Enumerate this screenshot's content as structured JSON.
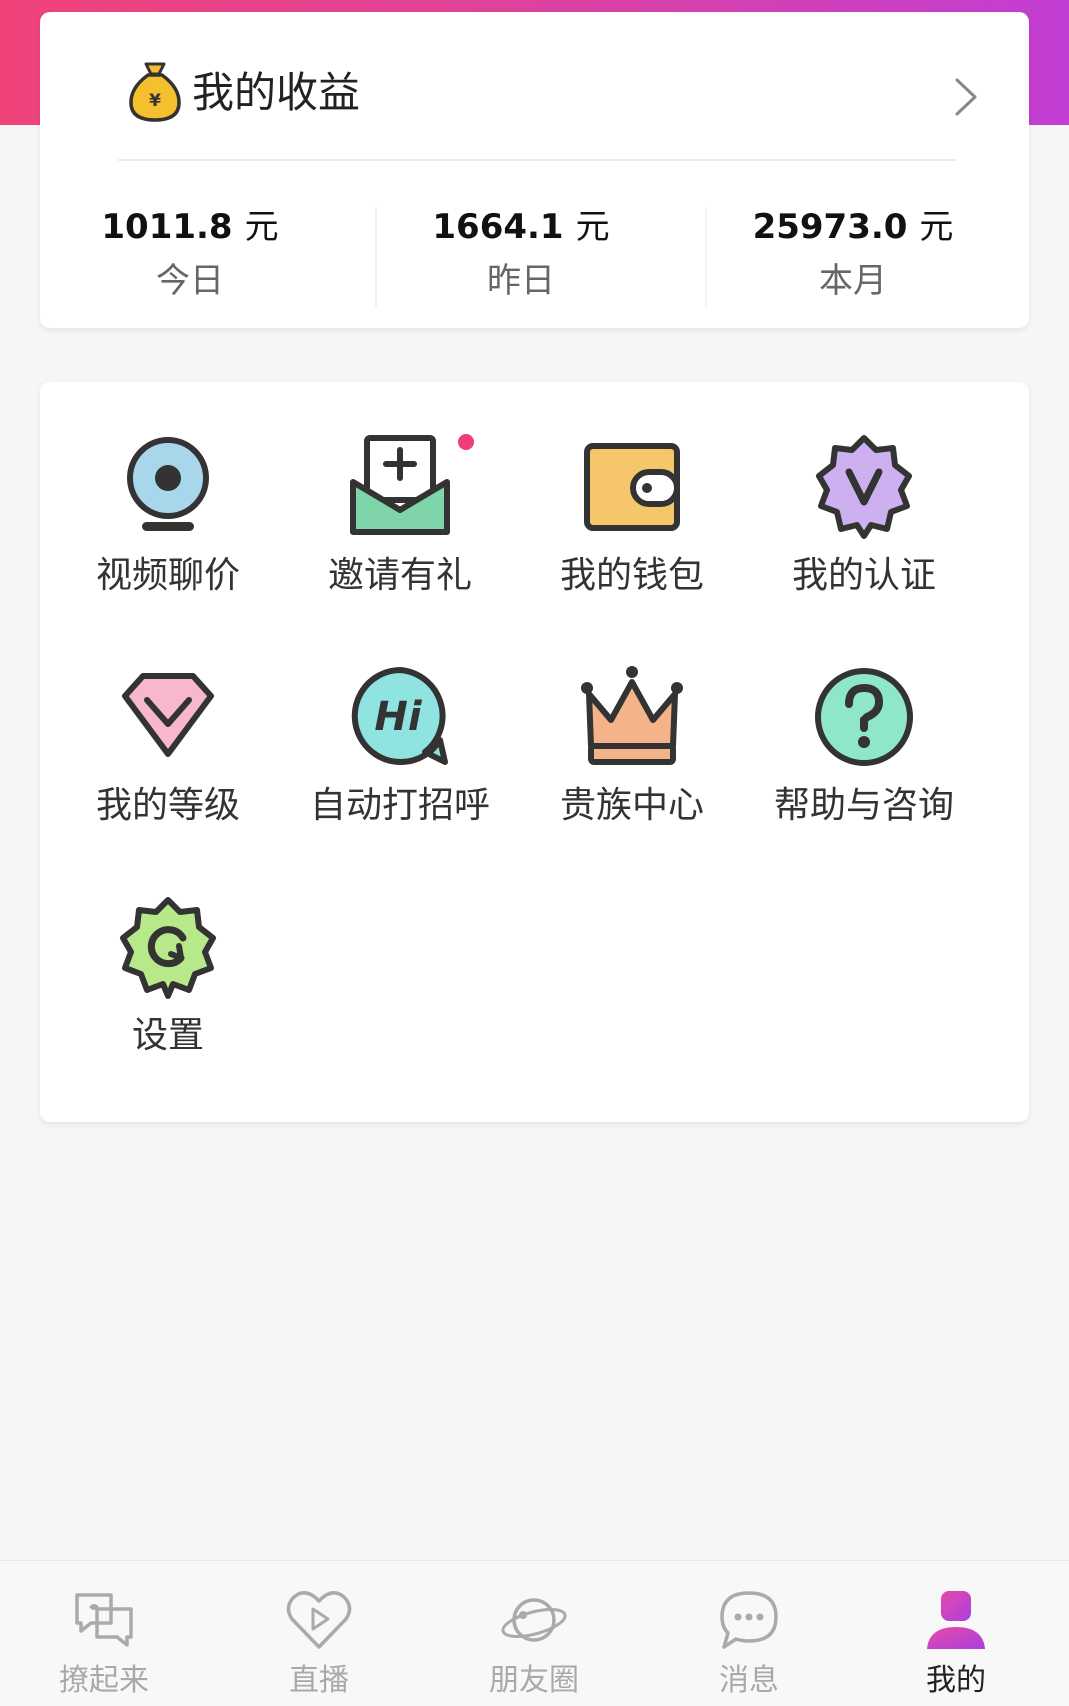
{
  "earnings": {
    "title": "我的收益",
    "stats": [
      {
        "value": "1011.8",
        "unit": "元",
        "label": "今日"
      },
      {
        "value": "1664.1",
        "unit": "元",
        "label": "昨日"
      },
      {
        "value": "25973.0",
        "unit": "元",
        "label": "本月"
      }
    ],
    "icon": "money-bag-icon"
  },
  "menu": {
    "items": [
      {
        "label": "视频聊价",
        "icon": "webcam-icon"
      },
      {
        "label": "邀请有礼",
        "icon": "invite-envelope-icon",
        "badge_dot": true
      },
      {
        "label": "我的钱包",
        "icon": "wallet-icon"
      },
      {
        "label": "我的认证",
        "icon": "verified-badge-icon"
      },
      {
        "label": "我的等级",
        "icon": "diamond-icon"
      },
      {
        "label": "自动打招呼",
        "icon": "hi-bubble-icon"
      },
      {
        "label": "贵族中心",
        "icon": "crown-icon"
      },
      {
        "label": "帮助与咨询",
        "icon": "help-icon"
      },
      {
        "label": "设置",
        "icon": "settings-gear-icon"
      }
    ]
  },
  "tabbar": {
    "items": [
      {
        "label": "撩起来",
        "icon": "chat-bubbles-icon",
        "active": false
      },
      {
        "label": "直播",
        "icon": "heart-play-icon",
        "active": false
      },
      {
        "label": "朋友圈",
        "icon": "planet-icon",
        "active": false
      },
      {
        "label": "消息",
        "icon": "message-icon",
        "active": false
      },
      {
        "label": "我的",
        "icon": "profile-icon",
        "active": true
      }
    ]
  },
  "colors": {
    "gradient_start": "#f0437a",
    "gradient_end": "#c23ed4",
    "badge_red": "#f03c79",
    "active_tab": "#b93fd8"
  }
}
